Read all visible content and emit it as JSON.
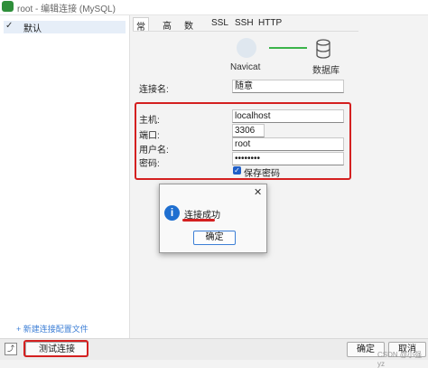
{
  "window": {
    "title": "root - 编辑连接 (MySQL)"
  },
  "left_panel": {
    "selected_item": "默认",
    "new_profile_link": "+ 新建连接配置文件"
  },
  "tabs": [
    {
      "label": "常规",
      "active": true
    },
    {
      "label": "高级",
      "active": false
    },
    {
      "label": "数据库",
      "active": false
    },
    {
      "label": "SSL",
      "active": false
    },
    {
      "label": "SSH",
      "active": false
    },
    {
      "label": "HTTP",
      "active": false
    }
  ],
  "illustration": {
    "left_label": "Navicat",
    "right_label": "数据库",
    "connector_color": "#3bb34a"
  },
  "form": {
    "connection_name": {
      "label": "连接名:",
      "value": "随意"
    },
    "host": {
      "label": "主机:",
      "value": "localhost"
    },
    "port": {
      "label": "端口:",
      "value": "3306"
    },
    "username": {
      "label": "用户名:",
      "value": "root"
    },
    "password": {
      "label": "密码:",
      "value": "••••••••"
    },
    "save_password": {
      "label": "保存密码",
      "checked": true
    }
  },
  "dialog": {
    "message": "连接成功",
    "ok_label": "确定",
    "close_glyph": "✕",
    "info_glyph": "i"
  },
  "bottom": {
    "test_label": "测试连接",
    "ok_label": "确定",
    "cancel_label": "取消",
    "watermark": "CSDN @小强yz"
  },
  "colors": {
    "accent": "#1f6fd0",
    "highlight_red": "#d42020",
    "app_icon": "#2f8f3a"
  }
}
